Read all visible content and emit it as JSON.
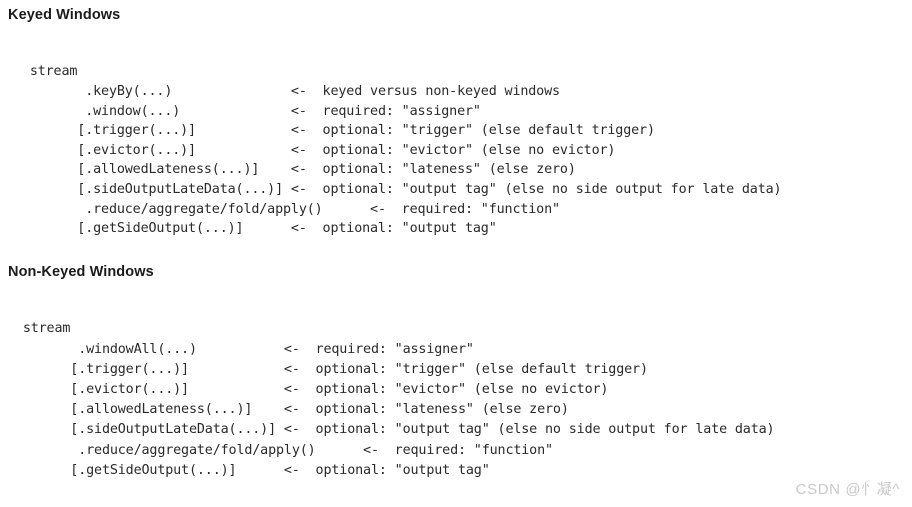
{
  "document": {
    "background_color": "#ffffff",
    "code_text_color": "#2a2a2a",
    "heading_text_color": "#1b1b1b",
    "watermark_color": "#c9c9c9"
  },
  "sections": [
    {
      "heading": "Keyed Windows",
      "code_lines": [
        "  stream",
        "         .keyBy(...)               <-  keyed versus non-keyed windows",
        "         .window(...)              <-  required: \"assigner\"",
        "        [.trigger(...)]            <-  optional: \"trigger\" (else default trigger)",
        "        [.evictor(...)]            <-  optional: \"evictor\" (else no evictor)",
        "        [.allowedLateness(...)]    <-  optional: \"lateness\" (else zero)",
        "        [.sideOutputLateData(...)] <-  optional: \"output tag\" (else no side output for late data)",
        "         .reduce/aggregate/fold/apply()      <-  required: \"function\"",
        "        [.getSideOutput(...)]      <-  optional: \"output tag\""
      ]
    },
    {
      "heading": "Non-Keyed Windows",
      "code_lines": [
        "  stream",
        "         .windowAll(...)           <-  required: \"assigner\"",
        "        [.trigger(...)]            <-  optional: \"trigger\" (else default trigger)",
        "        [.evictor(...)]            <-  optional: \"evictor\" (else no evictor)",
        "        [.allowedLateness(...)]    <-  optional: \"lateness\" (else zero)",
        "        [.sideOutputLateData(...)] <-  optional: \"output tag\" (else no side output for late data)",
        "         .reduce/aggregate/fold/apply()      <-  required: \"function\"",
        "        [.getSideOutput(...)]      <-  optional: \"output tag\""
      ]
    }
  ],
  "watermark": {
    "text": "CSDN @忄凝^"
  }
}
